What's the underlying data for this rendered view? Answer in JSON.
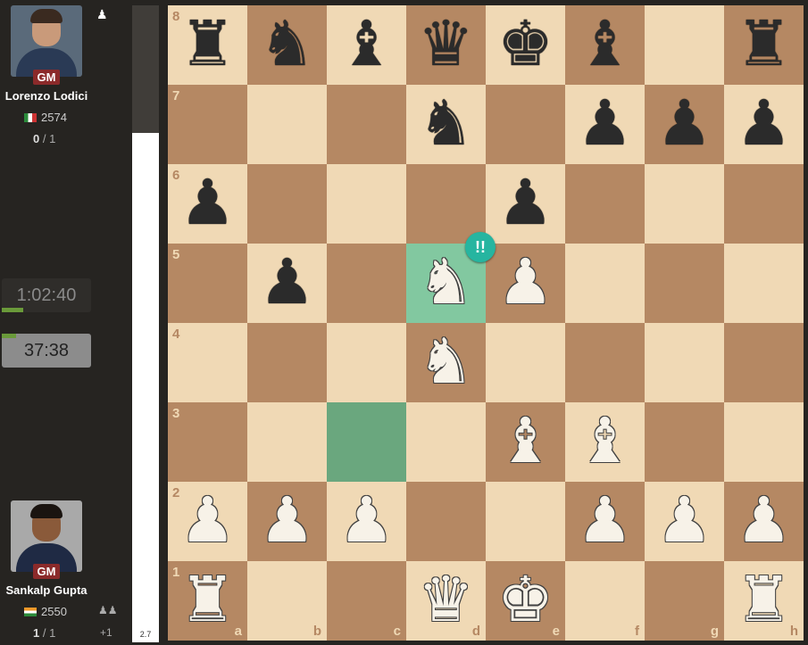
{
  "top_player": {
    "name": "Lorenzo Lodici",
    "title": "GM",
    "rating": "2574",
    "score_bold": "0",
    "score_rest": " / 1",
    "flag": "italy"
  },
  "bottom_player": {
    "name": "Sankalp Gupta",
    "title": "GM",
    "rating": "2550",
    "score_bold": "1",
    "score_rest": " / 1",
    "flag": "india",
    "extra": "+1"
  },
  "clocks": {
    "top": "1:02:40",
    "bottom": "37:38"
  },
  "eval": {
    "value": "2.7",
    "white_fraction": 0.8
  },
  "top_icon": "♟",
  "board": {
    "ranks": [
      "8",
      "7",
      "6",
      "5",
      "4",
      "3",
      "2",
      "1"
    ],
    "files": [
      "a",
      "b",
      "c",
      "d",
      "e",
      "f",
      "g",
      "h"
    ],
    "rows": [
      [
        "r",
        "n",
        "b",
        "q",
        "k",
        "b",
        "",
        "r"
      ],
      [
        "",
        "",
        "",
        "n",
        "",
        "p",
        "p",
        "p"
      ],
      [
        "p",
        "",
        "",
        "",
        "p",
        "",
        "",
        ""
      ],
      [
        "",
        "p",
        "",
        "N",
        "P",
        "",
        "",
        ""
      ],
      [
        "",
        "",
        "",
        "N",
        "",
        "",
        "",
        ""
      ],
      [
        "",
        "",
        "",
        "",
        "B",
        "B",
        "",
        ""
      ],
      [
        "P",
        "P",
        "P",
        "",
        "",
        "P",
        "P",
        "P"
      ],
      [
        "R",
        "",
        "",
        "Q",
        "K",
        "",
        "",
        "R"
      ]
    ],
    "highlight_from": "c3",
    "highlight_to": "d5",
    "annotation": "!!"
  },
  "colors": {
    "light": "#f0d9b5",
    "dark": "#b58863",
    "brilliant": "#26b5a0"
  }
}
